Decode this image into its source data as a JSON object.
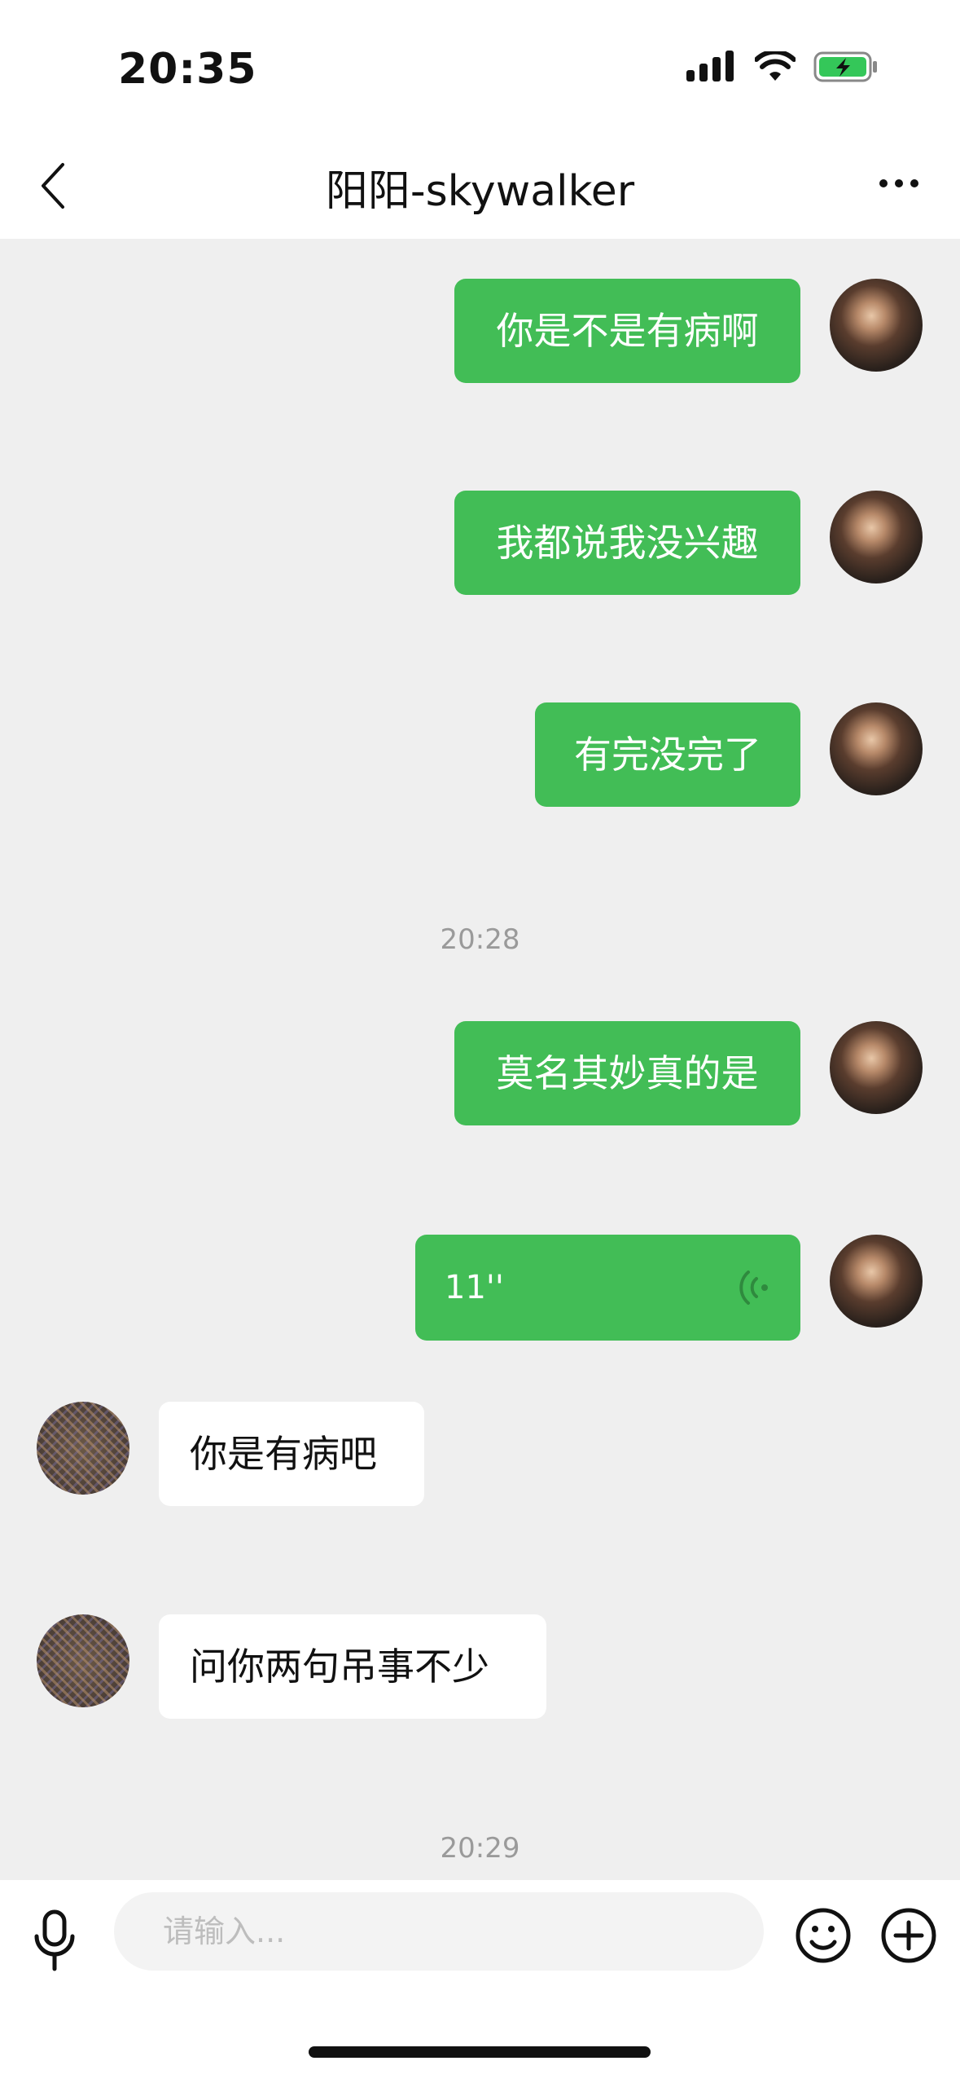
{
  "status_bar": {
    "time": "20:35"
  },
  "header": {
    "title": "阳阳-skywalker"
  },
  "messages": [
    {
      "text": "你是不是有病啊"
    },
    {
      "text": "我都说我没兴趣"
    },
    {
      "text": "有完没完了"
    },
    {
      "text": "20:28"
    },
    {
      "text": "莫名其妙真的是"
    },
    {
      "text": "11''"
    },
    {
      "text": "你是有病吧"
    },
    {
      "text": "问你两句吊事不少"
    },
    {
      "text": "20:29"
    }
  ],
  "input": {
    "placeholder": "请输入..."
  },
  "colors": {
    "bubble_out": "#42bd56",
    "bubble_in": "#ffffff",
    "chat_background": "#efefef"
  }
}
